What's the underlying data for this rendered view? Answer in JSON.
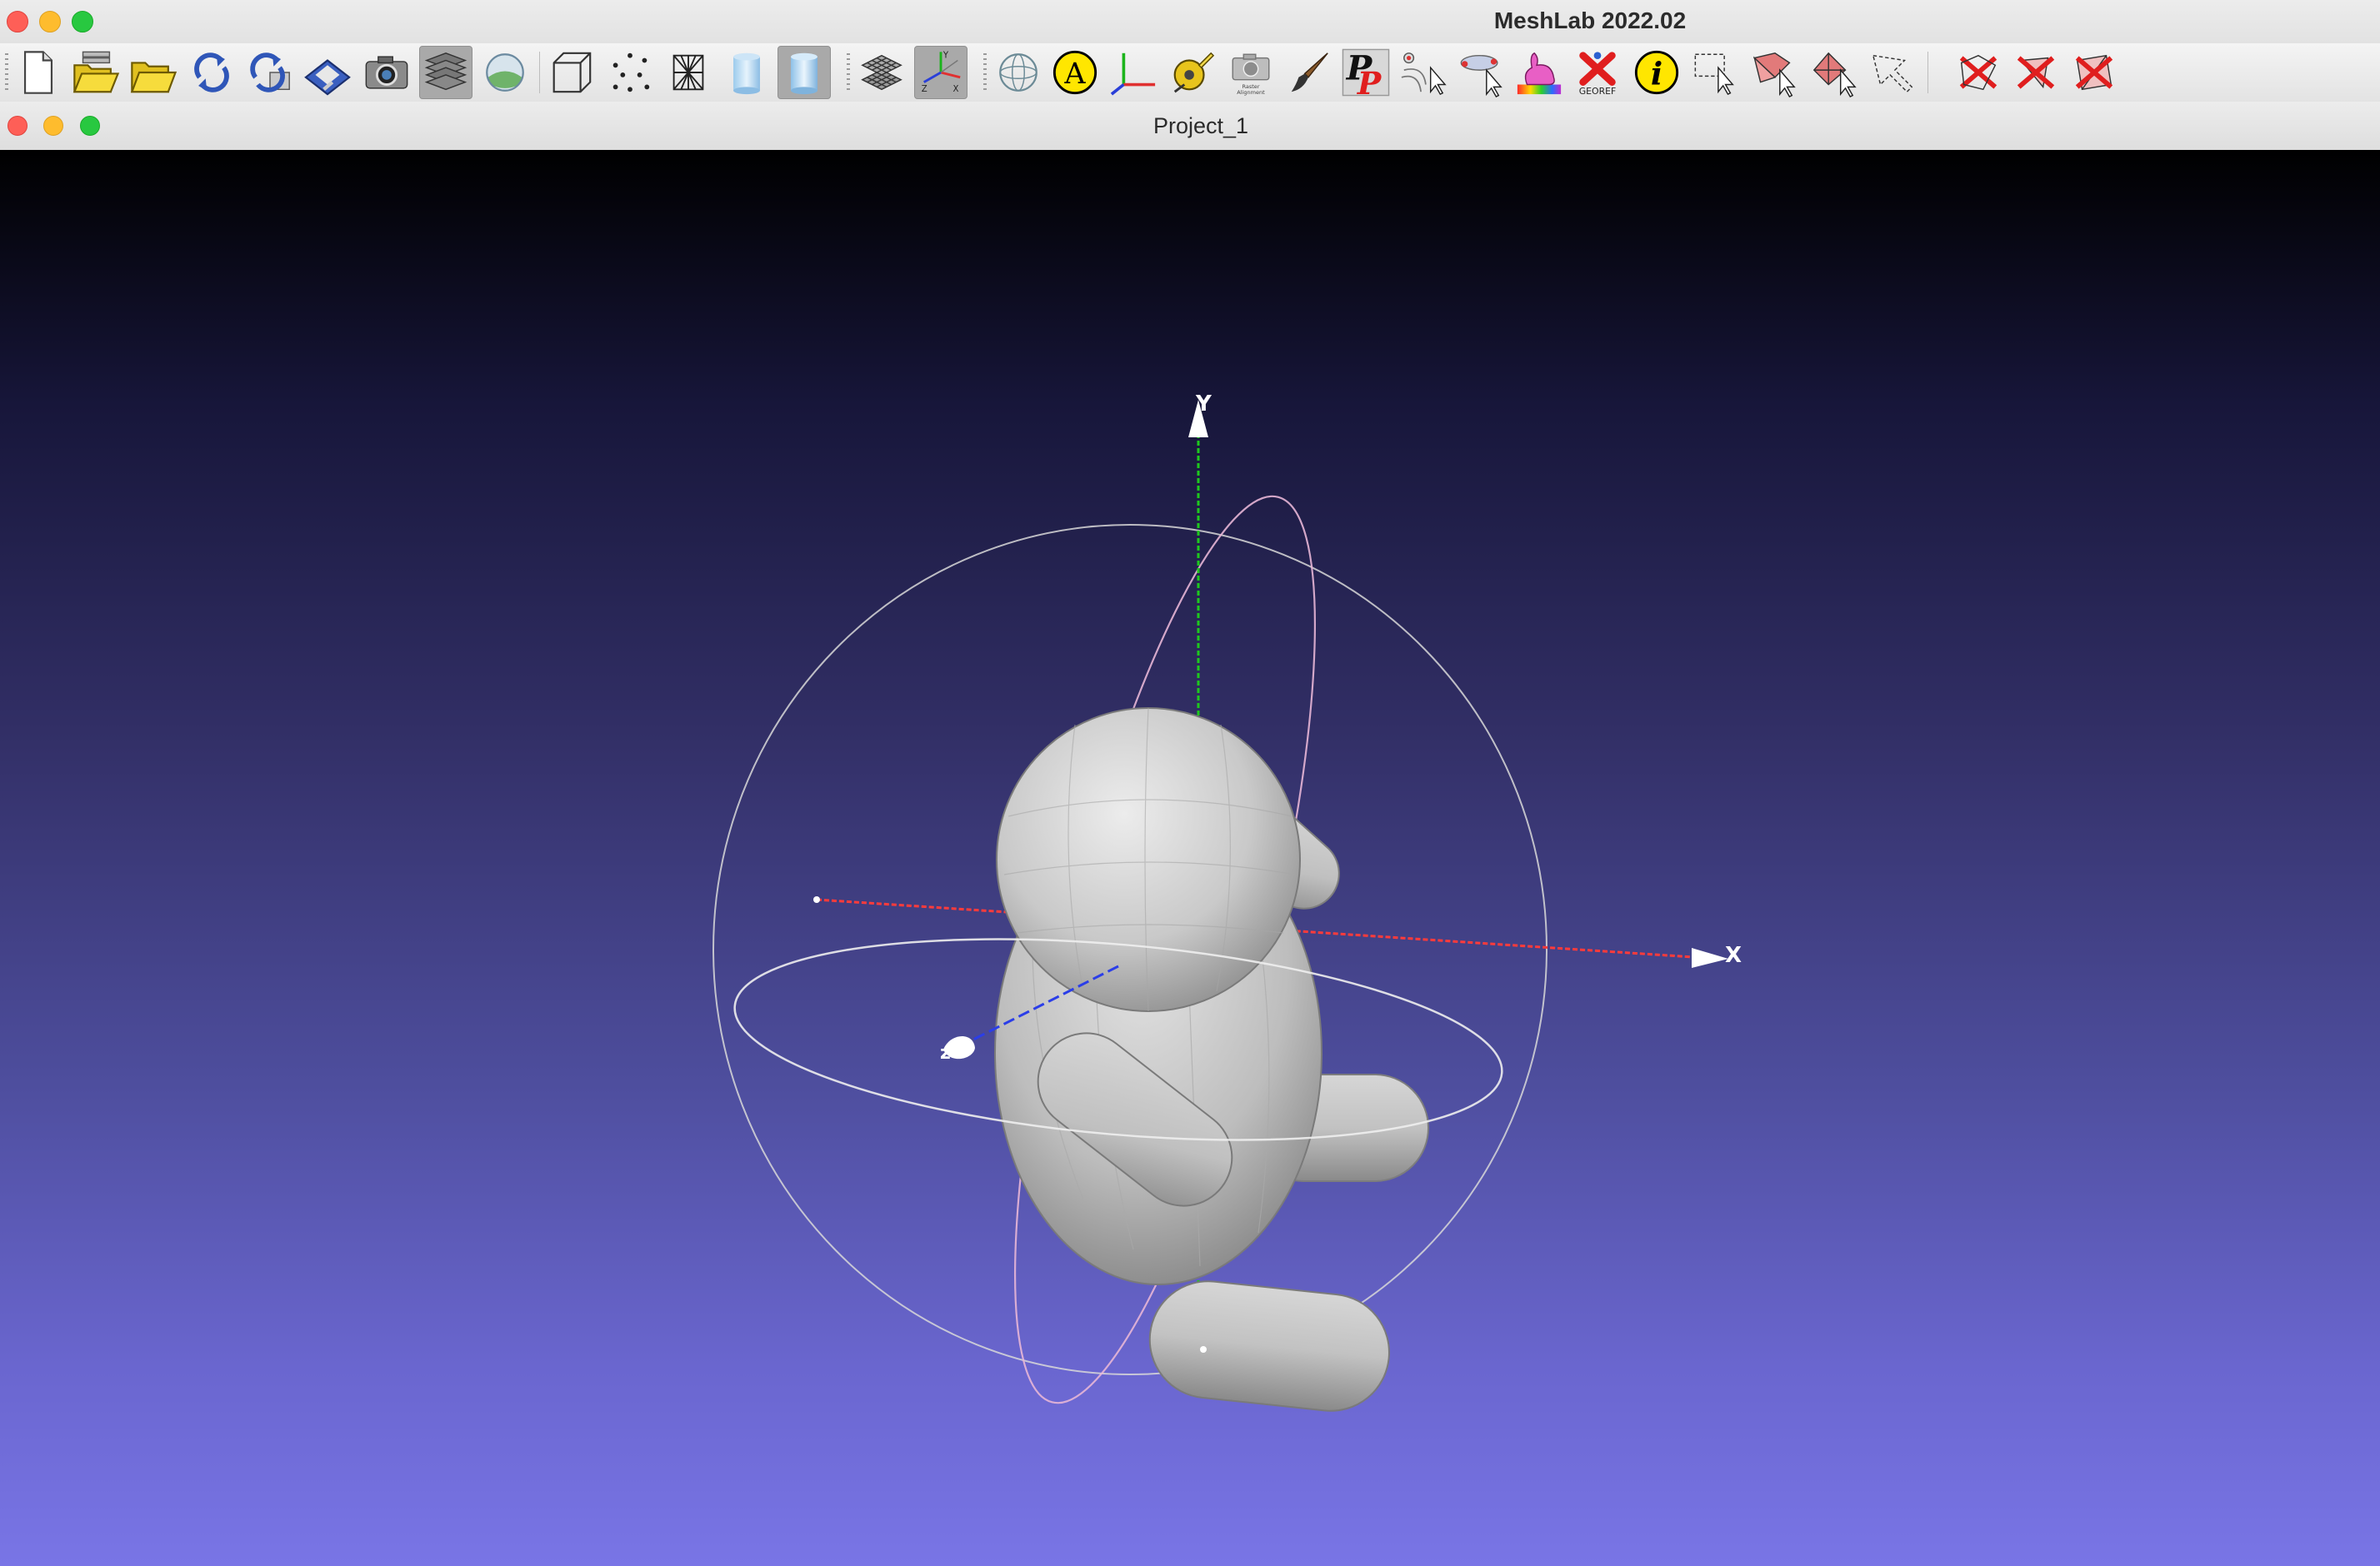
{
  "window": {
    "title": "MeshLab 2022.02",
    "document_title": "Project_1"
  },
  "toolbar": {
    "buttons": [
      {
        "name": "new-project-icon",
        "active": false
      },
      {
        "name": "open-project-icon",
        "active": false
      },
      {
        "name": "import-mesh-icon",
        "active": false
      },
      {
        "name": "reload-icon",
        "active": false
      },
      {
        "name": "reload-all-icon",
        "active": false
      },
      {
        "name": "save-icon",
        "active": false
      },
      {
        "name": "snapshot-icon",
        "active": false
      },
      {
        "name": "layers-icon",
        "active": true
      },
      {
        "name": "raster-view-icon",
        "active": false
      },
      {
        "name": "bounding-box-icon",
        "active": false
      },
      {
        "name": "points-icon",
        "active": false
      },
      {
        "name": "wireframe-icon",
        "active": false
      },
      {
        "name": "flat-shading-icon",
        "active": false
      },
      {
        "name": "smooth-shading-icon",
        "active": true
      },
      {
        "name": "grid-icon",
        "active": false
      },
      {
        "name": "axes-trackball-icon",
        "active": true
      },
      {
        "name": "sphere-icon",
        "active": false
      },
      {
        "name": "annotation-icon",
        "active": false
      },
      {
        "name": "align-icon",
        "active": false
      },
      {
        "name": "measure-tape-icon",
        "active": false
      },
      {
        "name": "raster-alignment-icon",
        "active": false
      },
      {
        "name": "paint-brush-icon",
        "active": false
      },
      {
        "name": "pickpoints-icon",
        "active": false
      },
      {
        "name": "point-picker-icon",
        "active": false
      },
      {
        "name": "segment-picker-icon",
        "active": false
      },
      {
        "name": "texture-bunny-icon",
        "active": false
      },
      {
        "name": "georef-icon",
        "active": false
      },
      {
        "name": "info-icon",
        "active": false
      },
      {
        "name": "select-vertices-icon",
        "active": false
      },
      {
        "name": "select-faces-icon",
        "active": false
      },
      {
        "name": "select-connected-icon",
        "active": false
      },
      {
        "name": "select-pointer-icon",
        "active": false
      },
      {
        "name": "delete-vertices-icon",
        "active": false
      },
      {
        "name": "delete-faces-icon",
        "active": false
      },
      {
        "name": "delete-faces-vertices-icon",
        "active": false
      }
    ],
    "raster_alignment_label": "Raster\nAlignment",
    "annotation_letter": "A",
    "info_letter": "i",
    "pickpoints_letter": "P",
    "georef_label": "GEOREF",
    "axes_labels": {
      "y": "Y",
      "z": "Z",
      "x": "X"
    }
  },
  "viewport": {
    "axis_labels": {
      "x": "X",
      "y": "Y",
      "z": "z"
    },
    "colors": {
      "x_axis": "#ff3b3b",
      "y_axis": "#1ec81e",
      "z_axis": "#2b3ee8",
      "trackball": "#e8e8e8",
      "mesh": "#cfcfcf"
    }
  }
}
